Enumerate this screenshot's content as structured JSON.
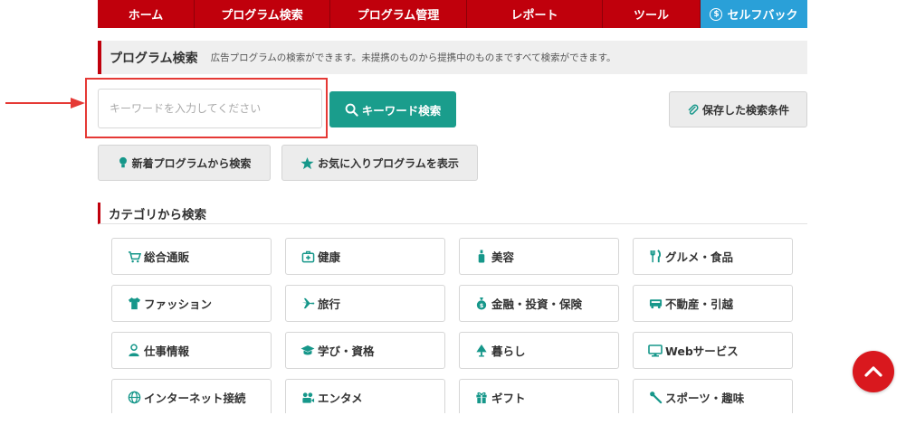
{
  "nav": {
    "items": [
      {
        "label": "ホーム",
        "width": 107
      },
      {
        "label": "プログラム検索",
        "width": 150
      },
      {
        "label": "プログラム管理",
        "width": 151
      },
      {
        "label": "レポート",
        "width": 150
      },
      {
        "label": "ツール",
        "width": 108
      },
      {
        "label": "セルフバック",
        "width": 118
      }
    ]
  },
  "section": {
    "title": "プログラム検索",
    "description": "広告プログラムの検索ができます。未提携のものから提携中のものまですべて検索ができます。"
  },
  "search": {
    "placeholder": "キーワードを入力してください",
    "button_label": "キーワード検索",
    "saved_label": "保存した検索条件"
  },
  "quick": {
    "new_label": "新着プログラムから検索",
    "fav_label": "お気に入りプログラムを表示"
  },
  "categories": {
    "heading": "カテゴリから検索",
    "items": [
      {
        "label": "総合通販",
        "icon": "cart-icon"
      },
      {
        "label": "健康",
        "icon": "first-aid-icon"
      },
      {
        "label": "美容",
        "icon": "bottle-icon"
      },
      {
        "label": "グルメ・食品",
        "icon": "fork-knife-icon"
      },
      {
        "label": "ファッション",
        "icon": "shirt-icon"
      },
      {
        "label": "旅行",
        "icon": "plane-icon"
      },
      {
        "label": "金融・投資・保険",
        "icon": "money-bag-icon"
      },
      {
        "label": "不動産・引越",
        "icon": "truck-icon"
      },
      {
        "label": "仕事情報",
        "icon": "person-icon"
      },
      {
        "label": "学び・資格",
        "icon": "graduation-cap-icon"
      },
      {
        "label": "暮らし",
        "icon": "lamp-icon"
      },
      {
        "label": "Webサービス",
        "icon": "monitor-icon"
      },
      {
        "label": "インターネット接続",
        "icon": "globe-icon"
      },
      {
        "label": "エンタメ",
        "icon": "film-icon"
      },
      {
        "label": "ギフト",
        "icon": "gift-icon"
      },
      {
        "label": "スポーツ・趣味",
        "icon": "sports-icon"
      }
    ]
  },
  "colors": {
    "nav_red": "#c0000c",
    "selfback_blue": "#2aa0d8",
    "teal": "#1a9d8c",
    "icon_teal": "#16978a",
    "highlight_red": "#e53935"
  }
}
